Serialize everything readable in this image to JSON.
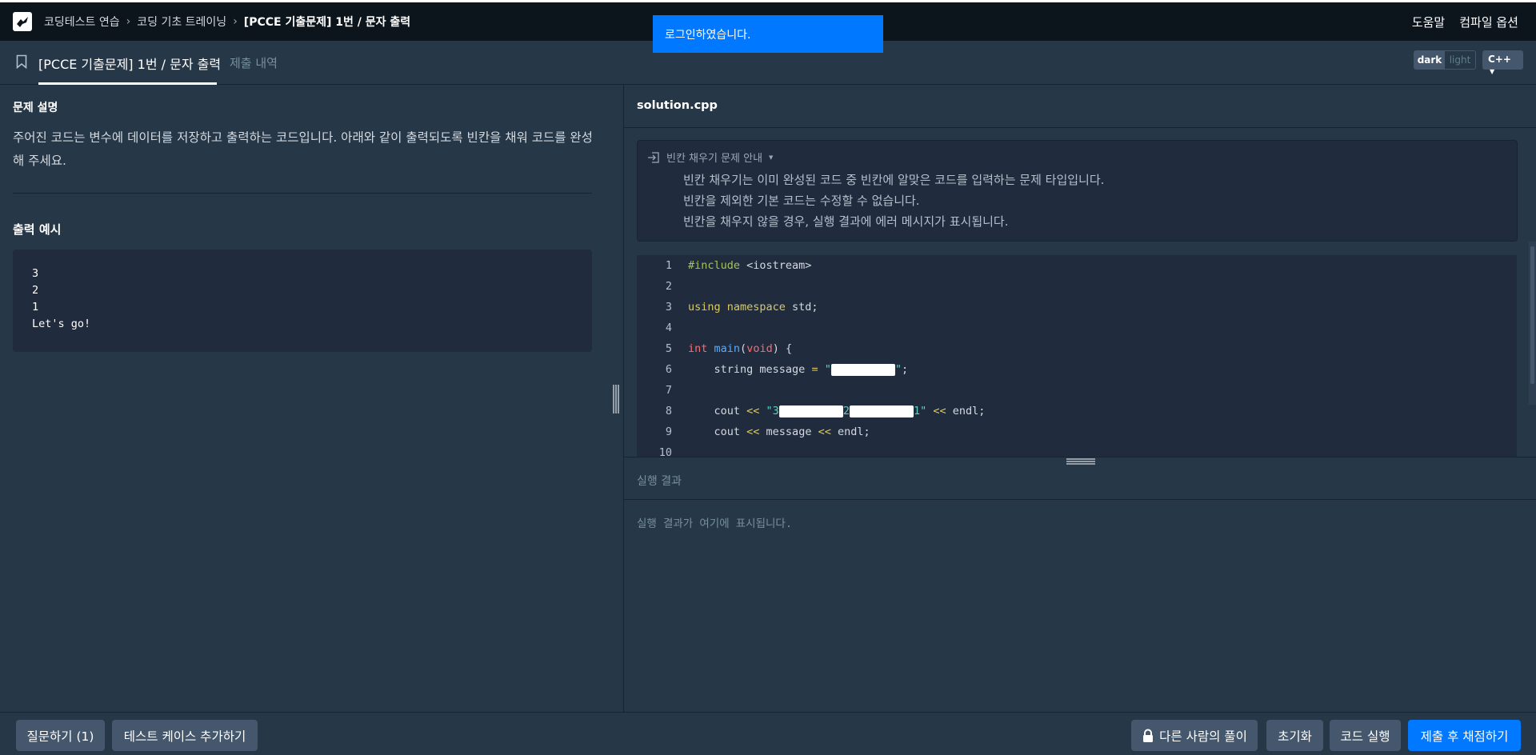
{
  "topbar": {
    "breadcrumb": [
      "코딩테스트 연습",
      "코딩 기초 트레이닝",
      "[PCCE 기출문제] 1번 / 문자 출력"
    ],
    "help": "도움말",
    "compile_options": "컴파일 옵션"
  },
  "toast": "로그인하였습니다.",
  "tabs": {
    "title": "[PCCE 기출문제] 1번 / 문자 출력",
    "history": "제출 내역"
  },
  "theme": {
    "dark": "dark",
    "light": "light",
    "selected": "dark"
  },
  "language": "C++",
  "problem": {
    "section_title": "문제 설명",
    "description": "주어진 코드는 변수에 데이터를 저장하고 출력하는 코드입니다. 아래와 같이 출력되도록 빈칸을 채워 코드를 완성해 주세요.",
    "output_title": "출력 예시",
    "output_example": "3\n2\n1\nLet's go!"
  },
  "editor": {
    "filename": "solution.cpp",
    "info_title": "빈칸 채우기 문제 안내",
    "info_lines": [
      "빈칸 채우기는 이미 완성된 코드 중 빈칸에 알맞은 코드를 입력하는 문제 타입입니다.",
      "빈칸을 제외한 기본 코드는 수정할 수 없습니다.",
      "빈칸을 채우지 않을 경우, 실행 결과에 에러 메시지가 표시됩니다."
    ],
    "line_numbers": [
      "1",
      "2",
      "3",
      "4",
      "5",
      "6",
      "7",
      "8",
      "9",
      "10"
    ],
    "code": {
      "l1_directive": "#include",
      "l1_header": " <iostream>",
      "l3_using": "using namespace",
      "l3_std": " std;",
      "l5_int": "int",
      "l5_main": "main",
      "l5_lparen": "(",
      "l5_void": "void",
      "l5_rest": ") {",
      "l6_a": "    string message ",
      "l6_eq": "=",
      "l6_q1": " \"",
      "l6_q2": "\"",
      "l6_end": ";",
      "l8_a": "    cout ",
      "l8_op": "<<",
      "l8_s1": " \"3",
      "l8_s2": "2",
      "l8_s3": "1\"",
      "l8_op2": " <<",
      "l8_end": " endl;",
      "l9_a": "    cout ",
      "l9_op": "<<",
      "l9_b": " message ",
      "l9_op2": "<<",
      "l9_end": " endl;"
    }
  },
  "result": {
    "header": "실행 결과",
    "placeholder": "실행 결과가 여기에 표시됩니다."
  },
  "bottom": {
    "ask": "질문하기 (1)",
    "add_testcase": "테스트 케이스 추가하기",
    "others_solutions": "다른 사람의 풀이",
    "reset": "초기화",
    "run": "코드 실행",
    "submit": "제출 후 채점하기"
  }
}
